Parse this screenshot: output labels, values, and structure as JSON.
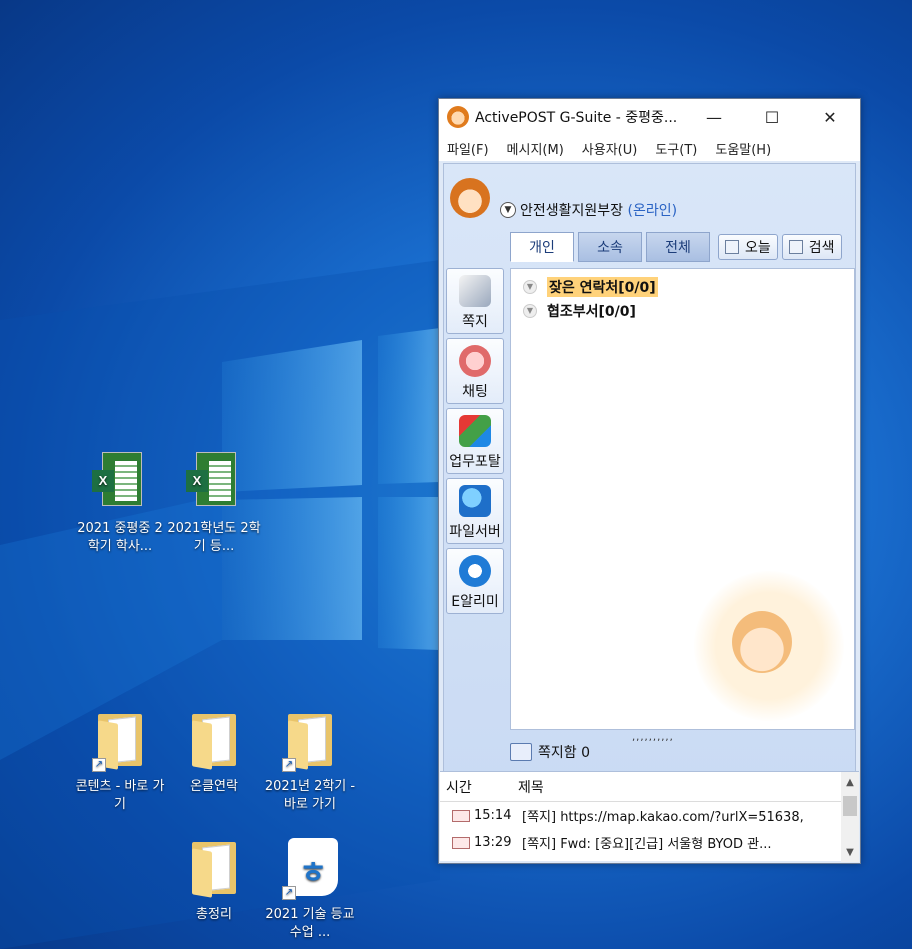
{
  "desktop": {
    "icons": [
      {
        "label": "2021 중평중 2학기 학사..."
      },
      {
        "label": "2021학년도 2학기 등..."
      },
      {
        "label": "콘텐츠 - 바로 가기"
      },
      {
        "label": "온클연락"
      },
      {
        "label": "2021년 2학기 - 바로 가기"
      },
      {
        "label": "총정리"
      },
      {
        "label": "2021 기술 등교 수업 ..."
      }
    ]
  },
  "window": {
    "title": "ActivePOST G-Suite - 중평중...",
    "controls": {
      "minimize": "—",
      "maximize": "☐",
      "close": "✕"
    },
    "menu": [
      "파일(F)",
      "메시지(M)",
      "사용자(U)",
      "도구(T)",
      "도움말(H)"
    ],
    "user": {
      "name": "안전생활지원부장",
      "status": "(온라인)"
    },
    "tabs": [
      "개인",
      "소속",
      "전체"
    ],
    "today_button": "오늘",
    "search_button": "검색",
    "side_buttons": [
      "쪽지",
      "채팅",
      "업무포탈",
      "파일서버",
      "E알리미"
    ],
    "tree": {
      "favorites": "잦은 연락처[0/0]",
      "cooperation": "협조부서[0/0]"
    },
    "inbox_label": "쪽지함 0",
    "message_list": {
      "headers": {
        "time": "시간",
        "subject": "제목"
      },
      "rows": [
        {
          "time": "15:14",
          "subject": "[쪽지] https://map.kakao.com/?urlX=51638,"
        },
        {
          "time": "13:29",
          "subject": "[쪽지] Fwd: [중요][긴급] 서울형 BYOD 관..."
        }
      ]
    }
  }
}
